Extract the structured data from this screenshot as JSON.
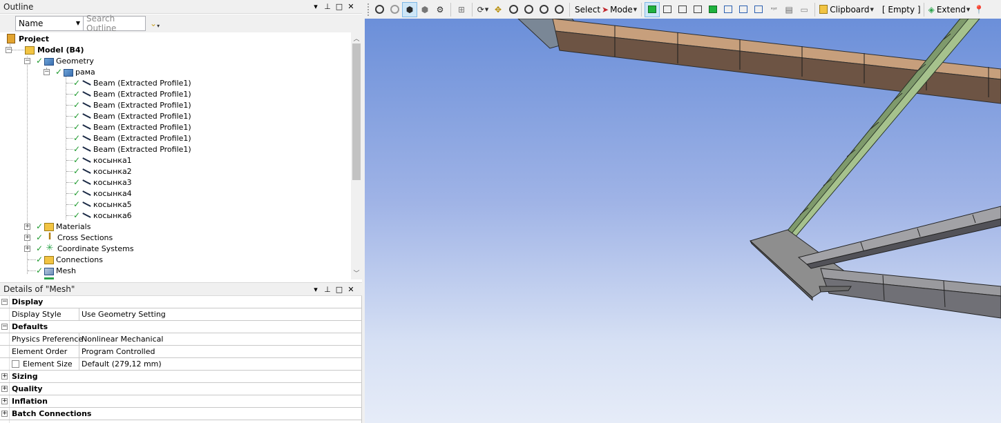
{
  "outline": {
    "title": "Outline",
    "name_filter": "Name",
    "search_placeholder": "Search Outline",
    "tree": {
      "project": "Project",
      "model": "Model (B4)",
      "geometry": "Geometry",
      "part": "рама",
      "bodies": [
        "Beam (Extracted Profile1)",
        "Beam (Extracted Profile1)",
        "Beam (Extracted Profile1)",
        "Beam (Extracted Profile1)",
        "Beam (Extracted Profile1)",
        "Beam (Extracted Profile1)",
        "Beam (Extracted Profile1)",
        "косынка1",
        "косынка2",
        "косынка3",
        "косынка4",
        "косынка5",
        "косынка6"
      ],
      "materials": "Materials",
      "cross_sections": "Cross Sections",
      "coordinate_systems": "Coordinate Systems",
      "connections": "Connections",
      "mesh": "Mesh"
    }
  },
  "details": {
    "title": "Details of \"Mesh\"",
    "groups": {
      "display": "Display",
      "defaults": "Defaults",
      "sizing": "Sizing",
      "quality": "Quality",
      "inflation": "Inflation",
      "batch_connections": "Batch Connections"
    },
    "rows": {
      "display_style_key": "Display Style",
      "display_style_val": "Use Geometry Setting",
      "physics_key": "Physics Preference",
      "physics_val": "Nonlinear Mechanical",
      "order_key": "Element Order",
      "order_val": "Program Controlled",
      "size_key": "Element Size",
      "size_val": "Default (279,12 mm)"
    }
  },
  "toolbar": {
    "select_label": "Select",
    "mode_label": "Mode",
    "clipboard_label": "Clipboard",
    "empty_label": "[ Empty ]",
    "extend_label": "Extend"
  },
  "colors": {
    "check_green": "#1e9a2e",
    "beam_tan": "#c9a07a",
    "gusset_green": "#a9c491",
    "steel_gray": "#8c8c8c",
    "viewport_top": "#6b8fd9",
    "viewport_bottom": "#e6ecf8"
  }
}
